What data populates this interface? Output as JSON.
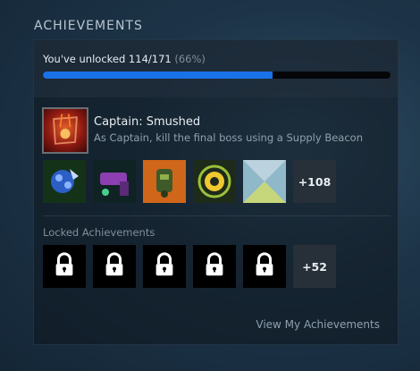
{
  "section": {
    "title": "ACHIEVEMENTS"
  },
  "progress": {
    "label": "You've unlocked 114/171",
    "percent_text": "(66%)",
    "fraction": 0.66
  },
  "featured": {
    "name": "Captain: Smushed",
    "description": "As Captain, kill the final boss using a Supply Beacon",
    "icon": "captain-smushed-icon"
  },
  "unlocked_icons": [
    {
      "name": "blue-crystal-creature-icon"
    },
    {
      "name": "purple-robot-weapon-icon"
    },
    {
      "name": "orange-backpack-creature-icon"
    },
    {
      "name": "gear-cog-icon"
    },
    {
      "name": "placeholder-triangles-icon"
    }
  ],
  "unlocked_more": "+108",
  "locked": {
    "label": "Locked Achievements",
    "count_icons": 5,
    "more": "+52"
  },
  "footer": {
    "link": "View My Achievements"
  },
  "colors": {
    "accent": "#1a72e8",
    "panel": "#0e161e"
  }
}
